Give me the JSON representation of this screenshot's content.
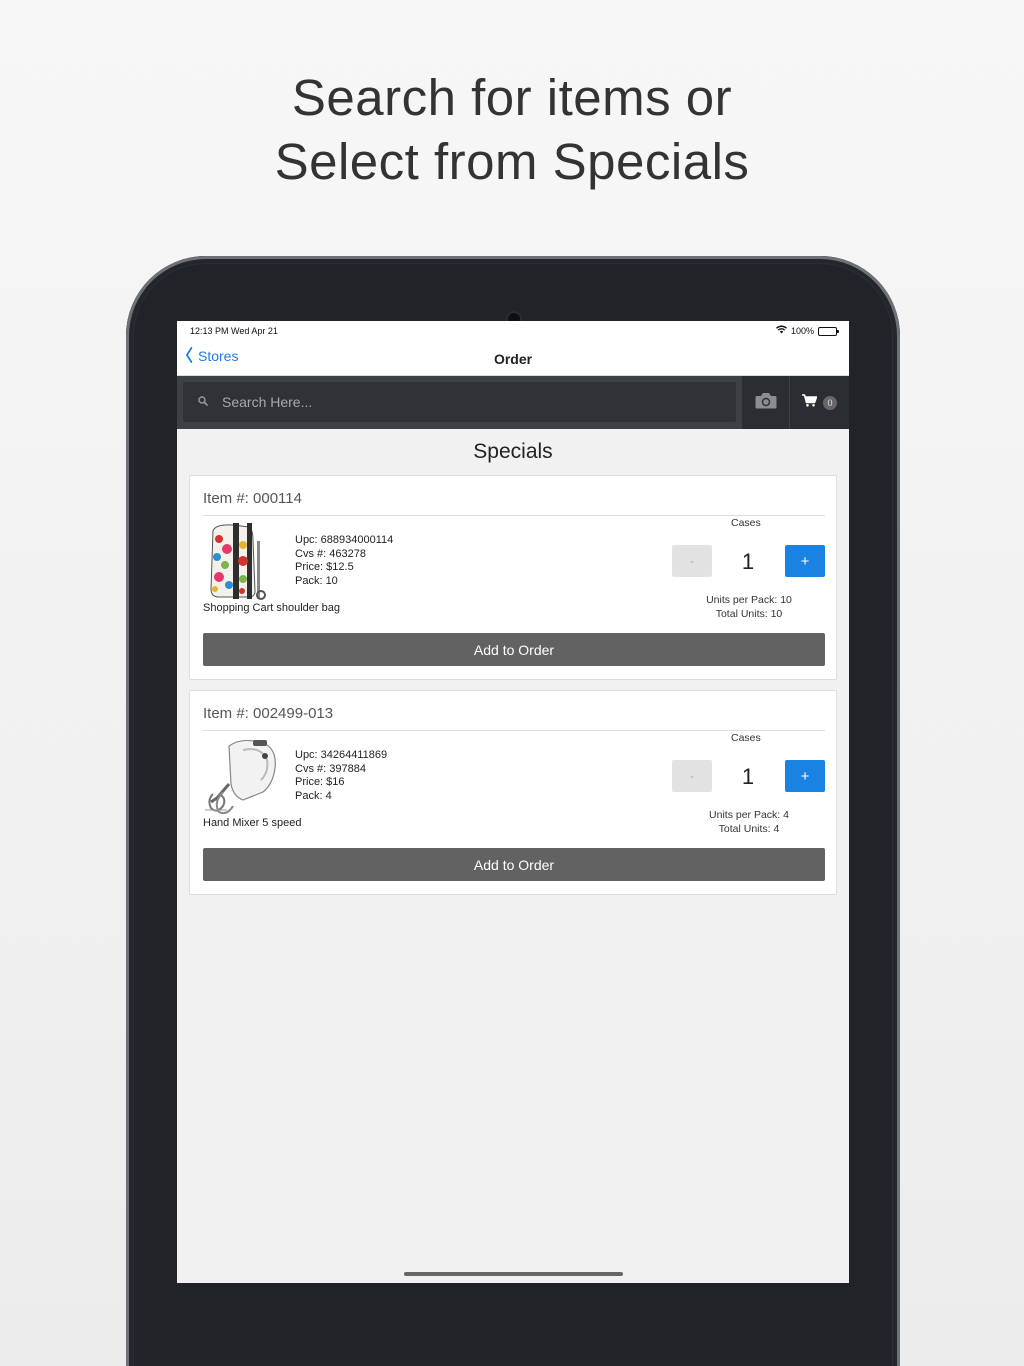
{
  "headline": {
    "line1": "Search for items or",
    "line2": "Select from Specials"
  },
  "status_bar": {
    "time": "12:13 PM   Wed Apr 21",
    "battery": "100%"
  },
  "nav": {
    "back_label": "Stores",
    "title": "Order"
  },
  "search": {
    "placeholder": "Search Here...",
    "cart_count": "0"
  },
  "specials": {
    "title": "Specials",
    "items": [
      {
        "item_no": "Item #: 000114",
        "upc": "Upc: 688934000114",
        "cvs": "Cvs #: 463278",
        "price": "Price: $12.5",
        "pack": "Pack: 10",
        "description": "Shopping Cart shoulder bag",
        "cases_label": "Cases",
        "minus_label": "-",
        "quantity": "1",
        "plus_label": "+",
        "units_per_pack": "Units per Pack: 10",
        "total_units": "Total Units: 10",
        "add_label": "Add to Order"
      },
      {
        "item_no": "Item #: 002499-013",
        "upc": "Upc: 34264411869",
        "cvs": "Cvs #: 397884",
        "price": "Price: $16",
        "pack": "Pack: 4",
        "description": "Hand Mixer 5 speed",
        "cases_label": "Cases",
        "minus_label": "-",
        "quantity": "1",
        "plus_label": "+",
        "units_per_pack": "Units per Pack: 4",
        "total_units": "Total Units: 4",
        "add_label": "Add to Order"
      }
    ]
  },
  "colors": {
    "accent": "#1a82e2",
    "link": "#1d7ce5",
    "button_dark": "#626262",
    "search_bar": "#3d4045"
  }
}
